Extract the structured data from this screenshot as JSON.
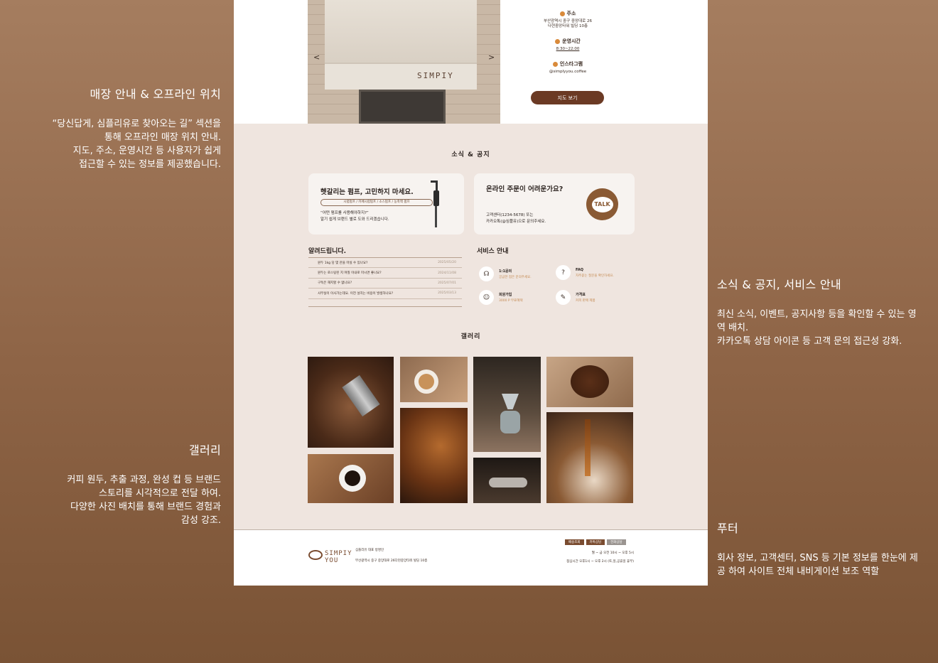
{
  "annotations": {
    "store": {
      "title": "매장 안내 & 오프라인 위치",
      "body": "“당신답게, 심플리유로 찾아오는 길” 섹션을\n통해 오프라인 매장 위치 안내.\n지도, 주소, 운영시간 등 사용자가 쉽게\n접근할 수 있는 정보를 제공했습니다."
    },
    "gallery": {
      "title": "갤러리",
      "body": "커피 원두, 추출 과정, 완성 컵 등 브랜드\n스토리를 시각적으로 전달 하여.\n다양한 사진 배치를 통해 브랜드 경험과\n감성 강조."
    },
    "news": {
      "title": "소식 & 공지, 서비스 안내",
      "body": "최신 소식, 이벤트, 공지사항 등을 확인할 수 있는 영역 배치.\n카카오톡 상담 아이콘 등 고객 문의 접근성 강화."
    },
    "footer": {
      "title": "푸터",
      "body": "회사 정보, 고객센터, SNS 등 기본 정보를 한눈에 제공 하여 사이트 전체 내비게이션 보조 역할"
    }
  },
  "store": {
    "sign": "SIMPIY",
    "prev": "<",
    "next": ">",
    "address_label": "주소",
    "address": "부산광역시 중구 중앙대로 26\n다현중앙타워 빌딩 10층",
    "hours_label": "운영시간",
    "hours": "8:30~22:00",
    "insta_label": "인스타그램",
    "insta": "@simplyyou.coffee",
    "map_button": "지도 보기"
  },
  "news": {
    "title": "소식 & 공지",
    "pump_card": {
      "title": "헷갈리는 펌프, 고민하지 마세요.",
      "tags": "시럽펌프 / 카페시럽펌프 / 소스펌프 / 농축액 펌프",
      "body": "“어떤 펌프를 사용해야하지?”\n알기 쉽게 브랜드 별로 도와 드리겠습니다."
    },
    "order_card": {
      "title": "온라인 주문이 어려운가요?",
      "body": "고객센터(1234-5678) 또는\n카카오톡(@심플유)으로 문의주세요.",
      "talk": "TALK"
    },
    "notice_title": "알려드립니다.",
    "notices": [
      {
        "text": "원두 1kg 당 몇 잔을 마실 수 있나요?",
        "date": "2025/05/20"
      },
      {
        "text": "원두는 로스팅된 지 며칠 이내로 마시면 좋나요?",
        "date": "2024/11/08"
      },
      {
        "text": "구독은 해지할 수 없나요?",
        "date": "2025/07/01"
      },
      {
        "text": "사무실이 이사가는데요. 이전 설치는 비용이 발생하나요?",
        "date": "2025/03/13"
      }
    ],
    "service_title": "서비스 안내",
    "services": [
      {
        "title": "1:1문의",
        "desc": "궁금한 점은 문의주세요."
      },
      {
        "title": "FAQ",
        "desc": "자주묻는 질문을 확인하세요."
      },
      {
        "title": "회원가입",
        "desc": "3000 P 무료혜택"
      },
      {
        "title": "가격표",
        "desc": "커피 판매 제품"
      }
    ],
    "gallery_title": "갤러리"
  },
  "footer": {
    "logo_line1": "SIMPIY",
    "logo_line2": "YOU",
    "company": "심플리유 대표 방명인",
    "address": "부산광역시 중구 중앙대로 26다현중앙타워 빌딩 10층",
    "buttons": [
      "배송조회",
      "카톡상담",
      "전화상담"
    ],
    "hours1": "월 ~ 금 오전 10시 ~ 오후 5시",
    "hours2": "점심시간 오후1시 ~ 오후 2시 (토,일,공휴일 휴무)"
  },
  "colors": {
    "accent": "#6b3a24",
    "background": "#efe5df",
    "gradient_top": "#a57d5f",
    "gradient_bottom": "#7a5335"
  }
}
